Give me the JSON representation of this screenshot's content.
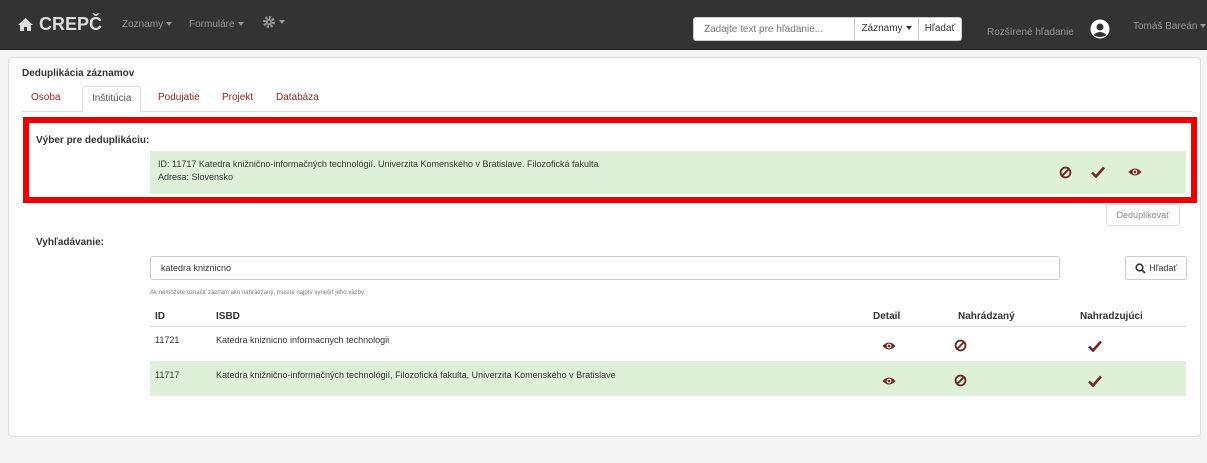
{
  "navbar": {
    "brand": "CREPČ",
    "menu_lists": "Zoznamy",
    "menu_forms": "Formuláre",
    "search_placeholder": "Zadajte text pre hľadanie...",
    "search_scope": "Záznamy",
    "search_button": "Hľadať",
    "advanced_search": "Rozšírené hľadanie",
    "user_name": "Tomáš Bareán"
  },
  "page": {
    "title": "Deduplikácia záznamov",
    "tabs": [
      "Osoba",
      "Inštitúcia",
      "Podujatie",
      "Projekt",
      "Databáza"
    ],
    "active_tab": "Inštitúcia"
  },
  "selection": {
    "label": "Výber pre deduplikáciu:",
    "line1": "ID: 11717 Katedra knižnično-informačných technológií. Univerzita Komenského v Bratislave. Filozofická fakulta",
    "line2": "Adresa: Slovensko"
  },
  "dedup_button": "Deduplikovať",
  "search": {
    "label": "Vyhľadávanie:",
    "query": "katedra kniznicno",
    "button": "Hľadať",
    "hint": "Ak nemôžete označiť záznam ako nahrádzaný, musíte najprv vyriešiť jeho väzby."
  },
  "table": {
    "headers": {
      "id": "ID",
      "isbd": "ISBD",
      "detail": "Detail",
      "replaced": "Nahrádzaný",
      "replacing": "Nahradzujúci"
    },
    "rows": [
      {
        "id": "11721",
        "isbd": "Katedra kniznicno informacnych technologii"
      },
      {
        "id": "11717",
        "isbd": "Katedra knižnično-informačných technológií, Filozofická fakulta, Univerzita Komenského v Bratislave"
      }
    ]
  },
  "colors": {
    "navbar": "#333333",
    "accent": "#6b2a22",
    "highlight_row": "#dff0d8",
    "selection_border": "#ee0000"
  }
}
